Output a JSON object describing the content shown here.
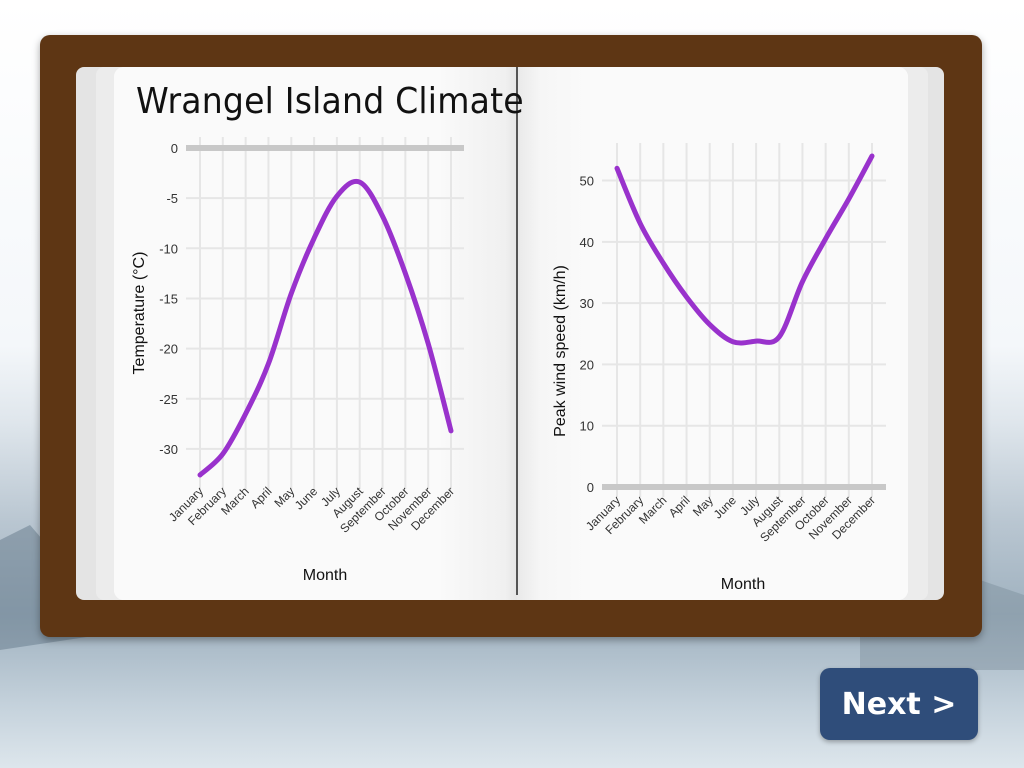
{
  "page": {
    "title": "Wrangel Island Climate",
    "next_button": "Next >"
  },
  "colors": {
    "line": "#9932cc",
    "board": "#5e3614",
    "button": "#2f4d7a"
  },
  "chart_data": [
    {
      "type": "line",
      "title": "",
      "xlabel": "Month",
      "ylabel": "Temperature (°C)",
      "categories": [
        "January",
        "February",
        "March",
        "April",
        "May",
        "June",
        "July",
        "August",
        "September",
        "October",
        "November",
        "December"
      ],
      "series": [
        {
          "values": [
            -32.6,
            -30.5,
            -26.5,
            -21.5,
            -14.5,
            -9.0,
            -4.8,
            -3.4,
            -6.8,
            -12.5,
            -19.5,
            -28.2
          ]
        }
      ],
      "ylim": [
        -33,
        0
      ],
      "yticks": [
        0,
        -5,
        -10,
        -15,
        -20,
        -25,
        -30
      ],
      "grid": true
    },
    {
      "type": "line",
      "title": "",
      "xlabel": "Month",
      "ylabel": "Peak wind speed (km/h)",
      "categories": [
        "January",
        "February",
        "March",
        "April",
        "May",
        "June",
        "July",
        "August",
        "September",
        "October",
        "November",
        "December"
      ],
      "series": [
        {
          "values": [
            52,
            43,
            36.5,
            31,
            26.5,
            23.7,
            23.8,
            24.5,
            33.5,
            40.5,
            47,
            54
          ]
        }
      ],
      "ylim": [
        0,
        54
      ],
      "yticks": [
        0,
        10,
        20,
        30,
        40,
        50
      ],
      "grid": true
    }
  ]
}
